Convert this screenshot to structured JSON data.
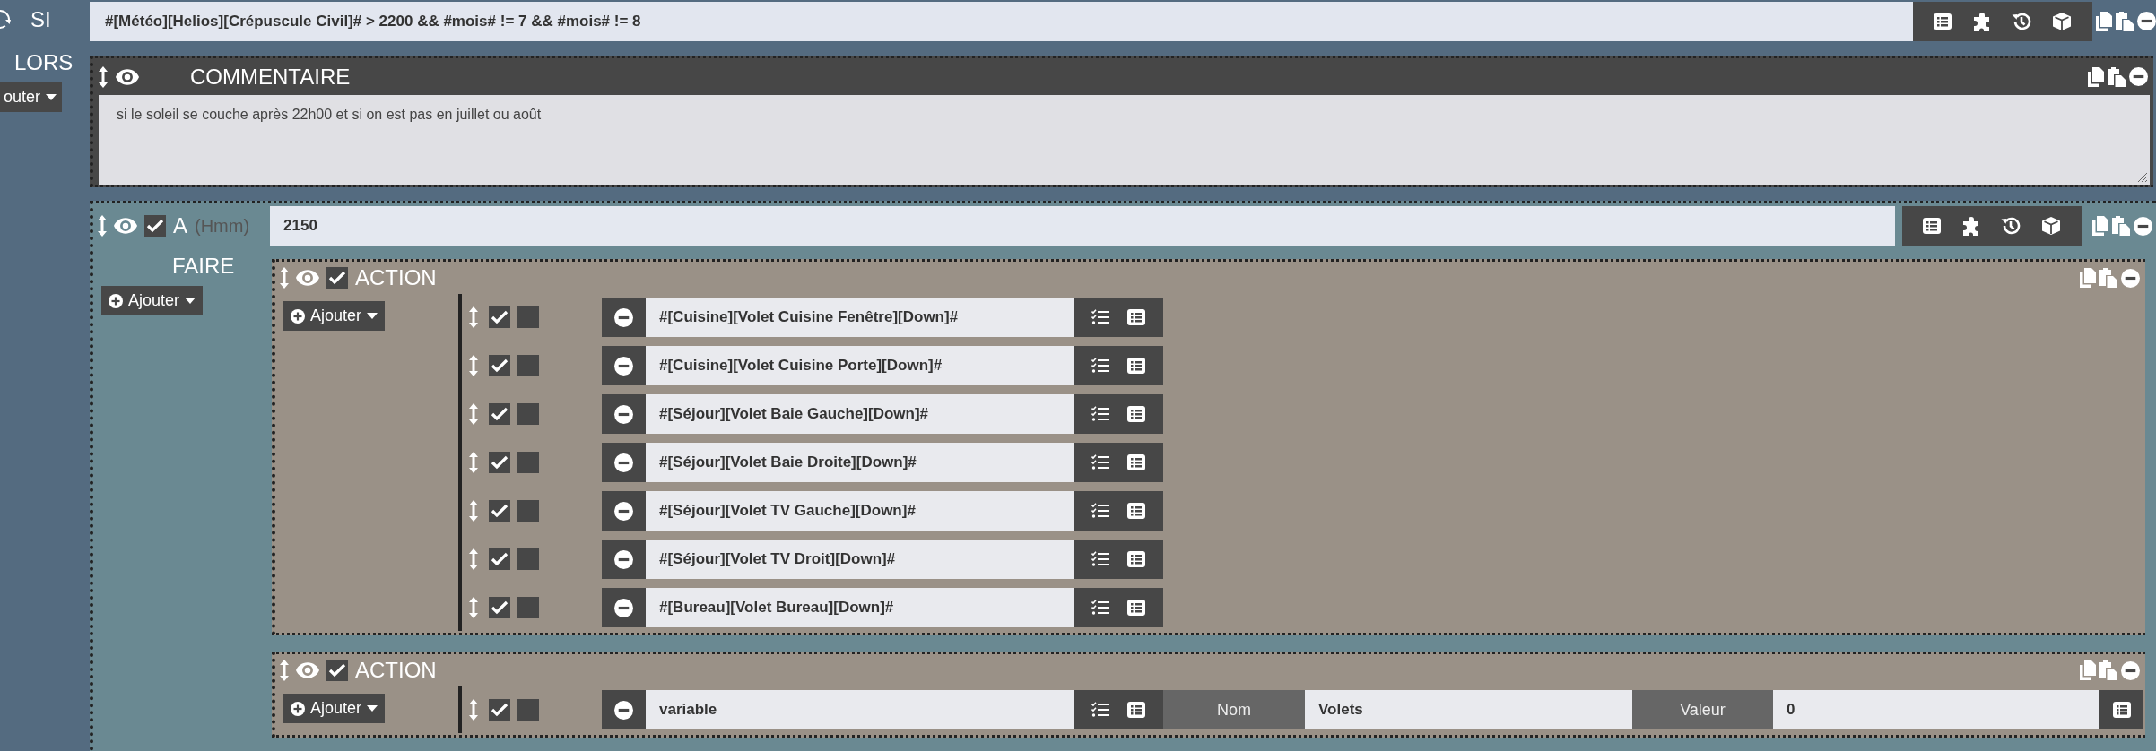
{
  "sidebar": {
    "condition_label": "SI",
    "then_label": "LORS",
    "add_button": "outer"
  },
  "condition": {
    "value": "#[Météo][Helios][Crépuscule Civil]# > 2200 && #mois# != 7 && #mois# != 8"
  },
  "comment": {
    "title": "COMMENTAIRE",
    "text": "si le soleil se couche après 22h00 et si on est pas en juillet ou août"
  },
  "block": {
    "label": "A",
    "hint": "(Hmm)",
    "checked": true,
    "value": "2150",
    "do_label": "FAIRE",
    "add_button": "Ajouter",
    "actions": [
      {
        "title": "ACTION",
        "checked": true,
        "add_button": "Ajouter",
        "rows": [
          {
            "kind": "command",
            "enabled": true,
            "parallel": false,
            "command": "#[Cuisine][Volet Cuisine Fenêtre][Down]#"
          },
          {
            "kind": "command",
            "enabled": true,
            "parallel": false,
            "command": "#[Cuisine][Volet Cuisine Porte][Down]#"
          },
          {
            "kind": "command",
            "enabled": true,
            "parallel": false,
            "command": "#[Séjour][Volet Baie Gauche][Down]#"
          },
          {
            "kind": "command",
            "enabled": true,
            "parallel": false,
            "command": "#[Séjour][Volet Baie Droite][Down]#"
          },
          {
            "kind": "command",
            "enabled": true,
            "parallel": false,
            "command": "#[Séjour][Volet TV Gauche][Down]#"
          },
          {
            "kind": "command",
            "enabled": true,
            "parallel": false,
            "command": "#[Séjour][Volet TV Droit][Down]#"
          },
          {
            "kind": "command",
            "enabled": true,
            "parallel": false,
            "command": "#[Bureau][Volet Bureau][Down]#"
          }
        ]
      },
      {
        "title": "ACTION",
        "checked": true,
        "add_button": "Ajouter",
        "rows": [
          {
            "kind": "variable",
            "enabled": true,
            "parallel": false,
            "command": "variable",
            "name_label": "Nom",
            "name": "Volets",
            "value_label": "Valeur",
            "value": "0"
          }
        ]
      }
    ]
  }
}
